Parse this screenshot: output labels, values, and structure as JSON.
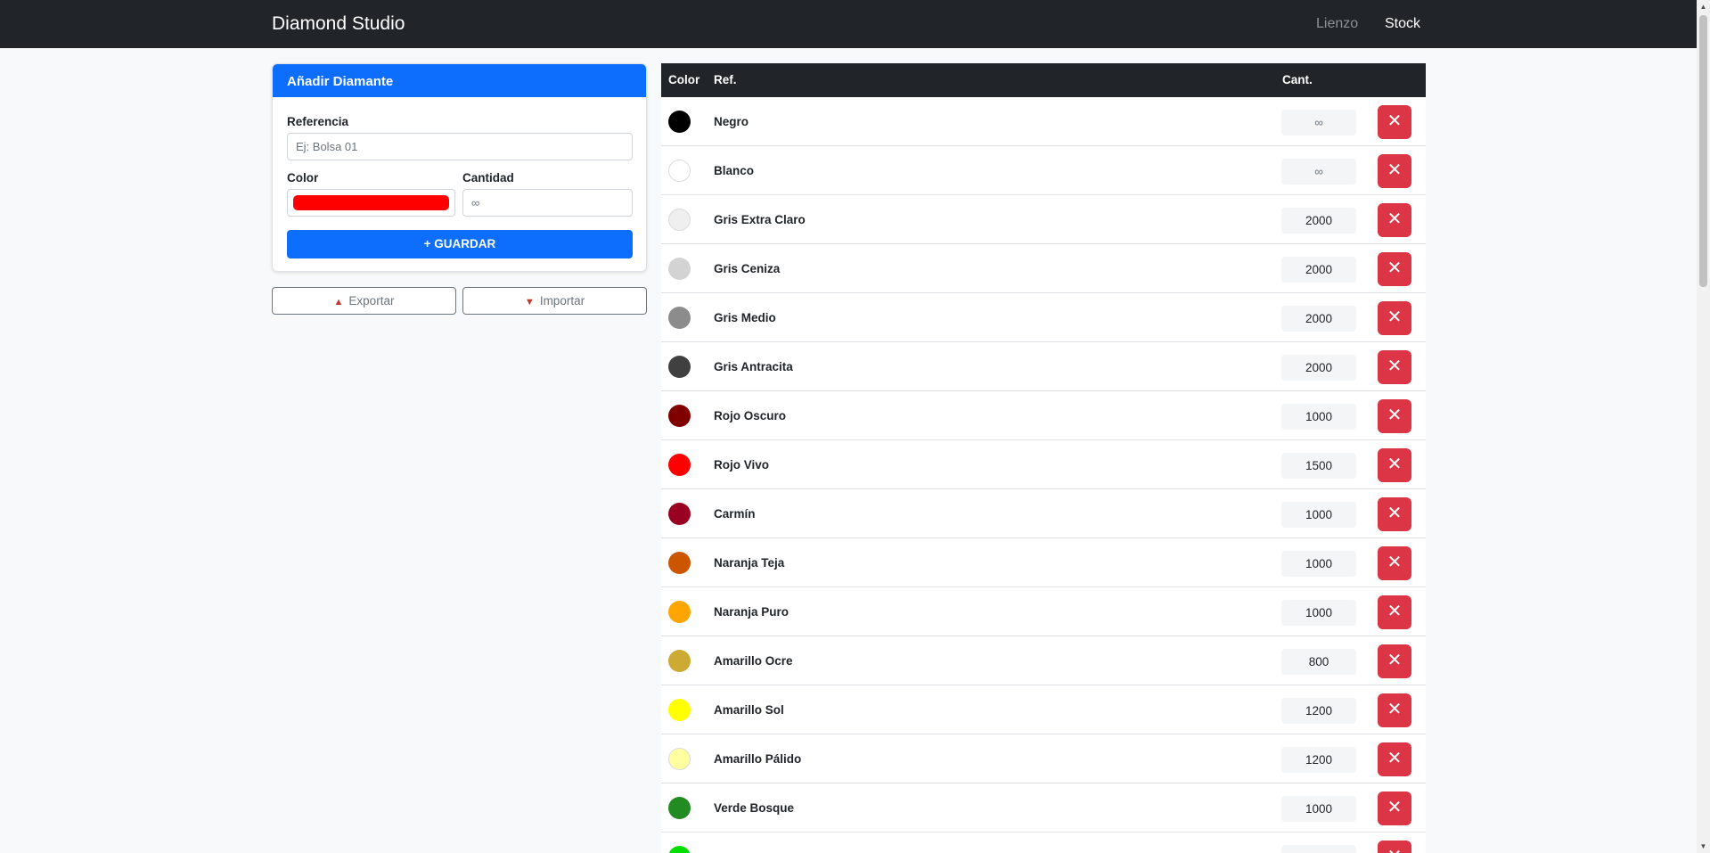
{
  "navbar": {
    "brand": "Diamond Studio",
    "links": [
      {
        "label": "Lienzo",
        "active": false
      },
      {
        "label": "Stock",
        "active": true
      }
    ]
  },
  "form": {
    "title": "Añadir Diamante",
    "ref_label": "Referencia",
    "ref_placeholder": "Ej: Bolsa 01",
    "color_label": "Color",
    "color_value": "#ff0000",
    "qty_label": "Cantidad",
    "qty_placeholder": "∞",
    "save_icon": "plus-icon",
    "save_label": "+ GUARDAR"
  },
  "actions": {
    "export_icon": "export-icon",
    "export_label": "Exportar",
    "import_icon": "import-icon",
    "import_label": "Importar"
  },
  "table": {
    "headers": {
      "color": "Color",
      "ref": "Ref.",
      "qty": "Cant."
    },
    "delete_icon": "close-icon",
    "rows": [
      {
        "color": "#000000",
        "ref": "Negro",
        "qty": "∞"
      },
      {
        "color": "#ffffff",
        "ref": "Blanco",
        "qty": "∞"
      },
      {
        "color": "#efefef",
        "ref": "Gris Extra Claro",
        "qty": "2000"
      },
      {
        "color": "#d3d3d3",
        "ref": "Gris Ceniza",
        "qty": "2000"
      },
      {
        "color": "#8c8c8c",
        "ref": "Gris Medio",
        "qty": "2000"
      },
      {
        "color": "#404040",
        "ref": "Gris Antracita",
        "qty": "2000"
      },
      {
        "color": "#800000",
        "ref": "Rojo Oscuro",
        "qty": "1000"
      },
      {
        "color": "#ff0000",
        "ref": "Rojo Vivo",
        "qty": "1500"
      },
      {
        "color": "#990022",
        "ref": "Carmín",
        "qty": "1000"
      },
      {
        "color": "#cc5500",
        "ref": "Naranja Teja",
        "qty": "1000"
      },
      {
        "color": "#ffa500",
        "ref": "Naranja Puro",
        "qty": "1000"
      },
      {
        "color": "#ccaa33",
        "ref": "Amarillo Ocre",
        "qty": "800"
      },
      {
        "color": "#ffff00",
        "ref": "Amarillo Sol",
        "qty": "1200"
      },
      {
        "color": "#ffffa0",
        "ref": "Amarillo Pálido",
        "qty": "1200"
      },
      {
        "color": "#228b22",
        "ref": "Verde Bosque",
        "qty": "1000"
      },
      {
        "color": "#00dd00",
        "ref": "",
        "qty": ""
      }
    ]
  }
}
